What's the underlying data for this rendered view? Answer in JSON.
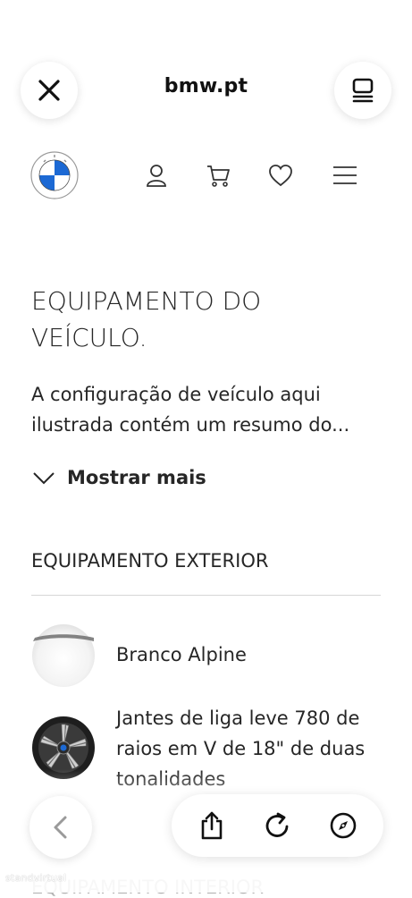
{
  "browser": {
    "domain": "bmw.pt",
    "close_icon": "close-icon",
    "tabs_icon": "tabs-icon"
  },
  "header": {
    "logo": "bmw-logo",
    "icons": [
      "user-icon",
      "cart-icon",
      "heart-icon",
      "menu-icon"
    ]
  },
  "main": {
    "title": "EQUIPAMENTO DO VEÍCULO.",
    "description": "A configuração de veículo aqui ilustrada contém um resumo do...",
    "show_more": "Mostrar mais",
    "exterior_heading": "EQUIPAMENTO EXTERIOR",
    "items": [
      {
        "label": "Branco Alpine",
        "icon": "paint-swatch-thumbnail"
      },
      {
        "label": "Jantes de liga leve 780 de raios em V de 18\" de duas tonalidades",
        "icon": "wheel-thumbnail"
      }
    ],
    "next_heading": "EQUIPAMENTO INTERIOR"
  },
  "toolbar": {
    "icons": [
      "back-icon",
      "share-icon",
      "reload-icon",
      "compass-icon"
    ]
  },
  "watermark": "standvirtual",
  "colors": {
    "text": "#262626",
    "bmw_blue": "#1c69d4",
    "divider": "#d6d6d6"
  }
}
